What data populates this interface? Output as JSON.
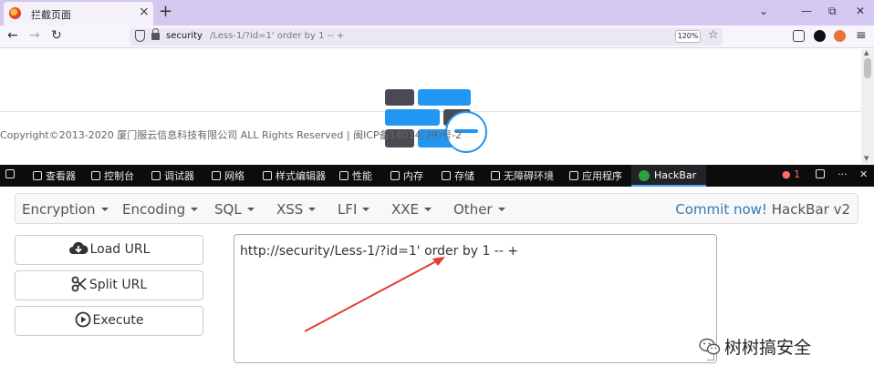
{
  "tab": {
    "title": "拦截页面",
    "close_glyph": "×"
  },
  "new_tab_glyph": "+",
  "window_controls": {
    "minimize": "⌄",
    "min2": "—",
    "restore": "⧉",
    "close": "✕"
  },
  "nav": {
    "back": "←",
    "forward": "→",
    "reload": "↻"
  },
  "address": {
    "host": "security",
    "path": "/Less-1/?id=1' order by 1 -- +",
    "zoom": "120%"
  },
  "page": {
    "copyright": "Copyright©2013-2020 厦门服云信息科技有限公司 ALL Rights Reserved | 闽ICP备14014(39)号-2"
  },
  "devtools": {
    "tabs": [
      "查看器",
      "控制台",
      "调试器",
      "网络",
      "样式编辑器",
      "性能",
      "内存",
      "存储",
      "无障碍环境",
      "应用程序"
    ],
    "active_tab": "HackBar",
    "error_count": "1",
    "more": "···",
    "close": "✕"
  },
  "hackbar": {
    "menus": [
      "Encryption",
      "Encoding",
      "SQL",
      "XSS",
      "LFI",
      "XXE",
      "Other"
    ],
    "commit_link": "Commit now!",
    "version": "HackBar v2",
    "buttons": {
      "load": "Load URL",
      "split": "Split URL",
      "execute": "Execute"
    },
    "url_value": "http://security/Less-1/?id=1' order by 1 -- +"
  },
  "watermark": "树树搞安全",
  "colors": {
    "accent_blue": "#2196f3",
    "brick_dark": "#4a4a55",
    "arrow_red": "#e53935",
    "link": "#337ab7"
  }
}
